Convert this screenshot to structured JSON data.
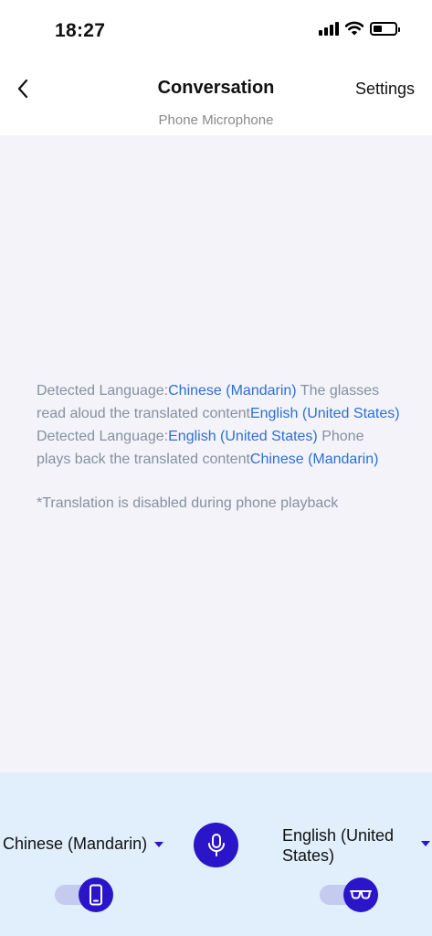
{
  "status_bar": {
    "time": "18:27",
    "icons": [
      "signal-icon",
      "wifi-icon",
      "battery-icon"
    ]
  },
  "header": {
    "back_icon": "chevron-left-icon",
    "title": "Conversation",
    "settings_label": "Settings",
    "mic_source": "Phone Microphone"
  },
  "info": {
    "line1_prefix": "Detected Language:",
    "line1_lang": "Chinese (Mandarin)",
    "line1_mid": " The glasses read aloud the translated content",
    "line1_target": "English (United States)",
    "line2_prefix": "Detected Language:",
    "line2_lang": "English (United States)",
    "line2_mid": " Phone plays back the translated content",
    "line2_target": "Chinese (Mandarin)",
    "note": "*Translation is disabled during phone playback"
  },
  "bottom": {
    "left_language": "Chinese (Mandarin)",
    "right_language": "English (United States)",
    "mic_icon": "microphone-icon",
    "phone_toggle_on": true,
    "glasses_toggle_on": true
  },
  "colors": {
    "accent": "#2a16c8",
    "link": "#2f6fd6",
    "muted_text": "#8790a0",
    "content_bg": "#f3f3f9",
    "bottom_bg": "#e1eefb",
    "toggle_track": "#c4cbef"
  }
}
